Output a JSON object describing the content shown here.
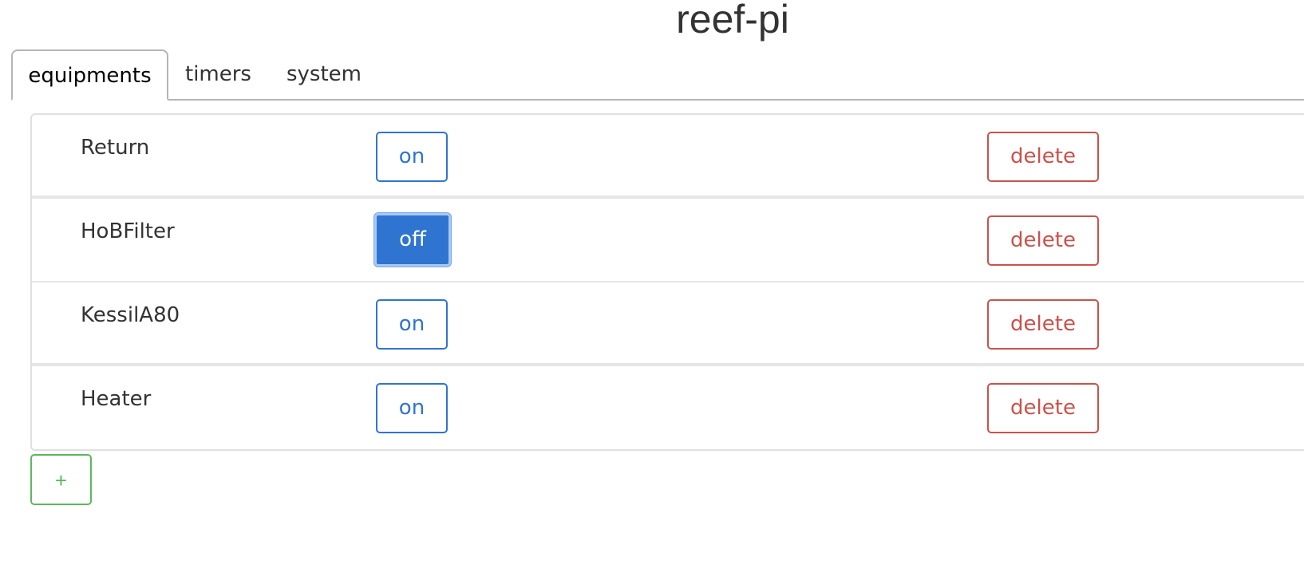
{
  "app": {
    "title": "reef-pi"
  },
  "tabs": [
    {
      "label": "equipments",
      "active": true
    },
    {
      "label": "timers",
      "active": false
    },
    {
      "label": "system",
      "active": false
    }
  ],
  "equipments": [
    {
      "name": "Return",
      "toggle_label": "on",
      "delete_label": "delete"
    },
    {
      "name": "HoBFilter",
      "toggle_label": "off",
      "delete_label": "delete"
    },
    {
      "name": "KessilA80",
      "toggle_label": "on",
      "delete_label": "delete"
    },
    {
      "name": "Heater",
      "toggle_label": "on",
      "delete_label": "delete"
    }
  ],
  "add_button": {
    "label": "+"
  },
  "colors": {
    "primary": "#2f74d0",
    "danger": "#c9524b",
    "success": "#5cb85c"
  }
}
